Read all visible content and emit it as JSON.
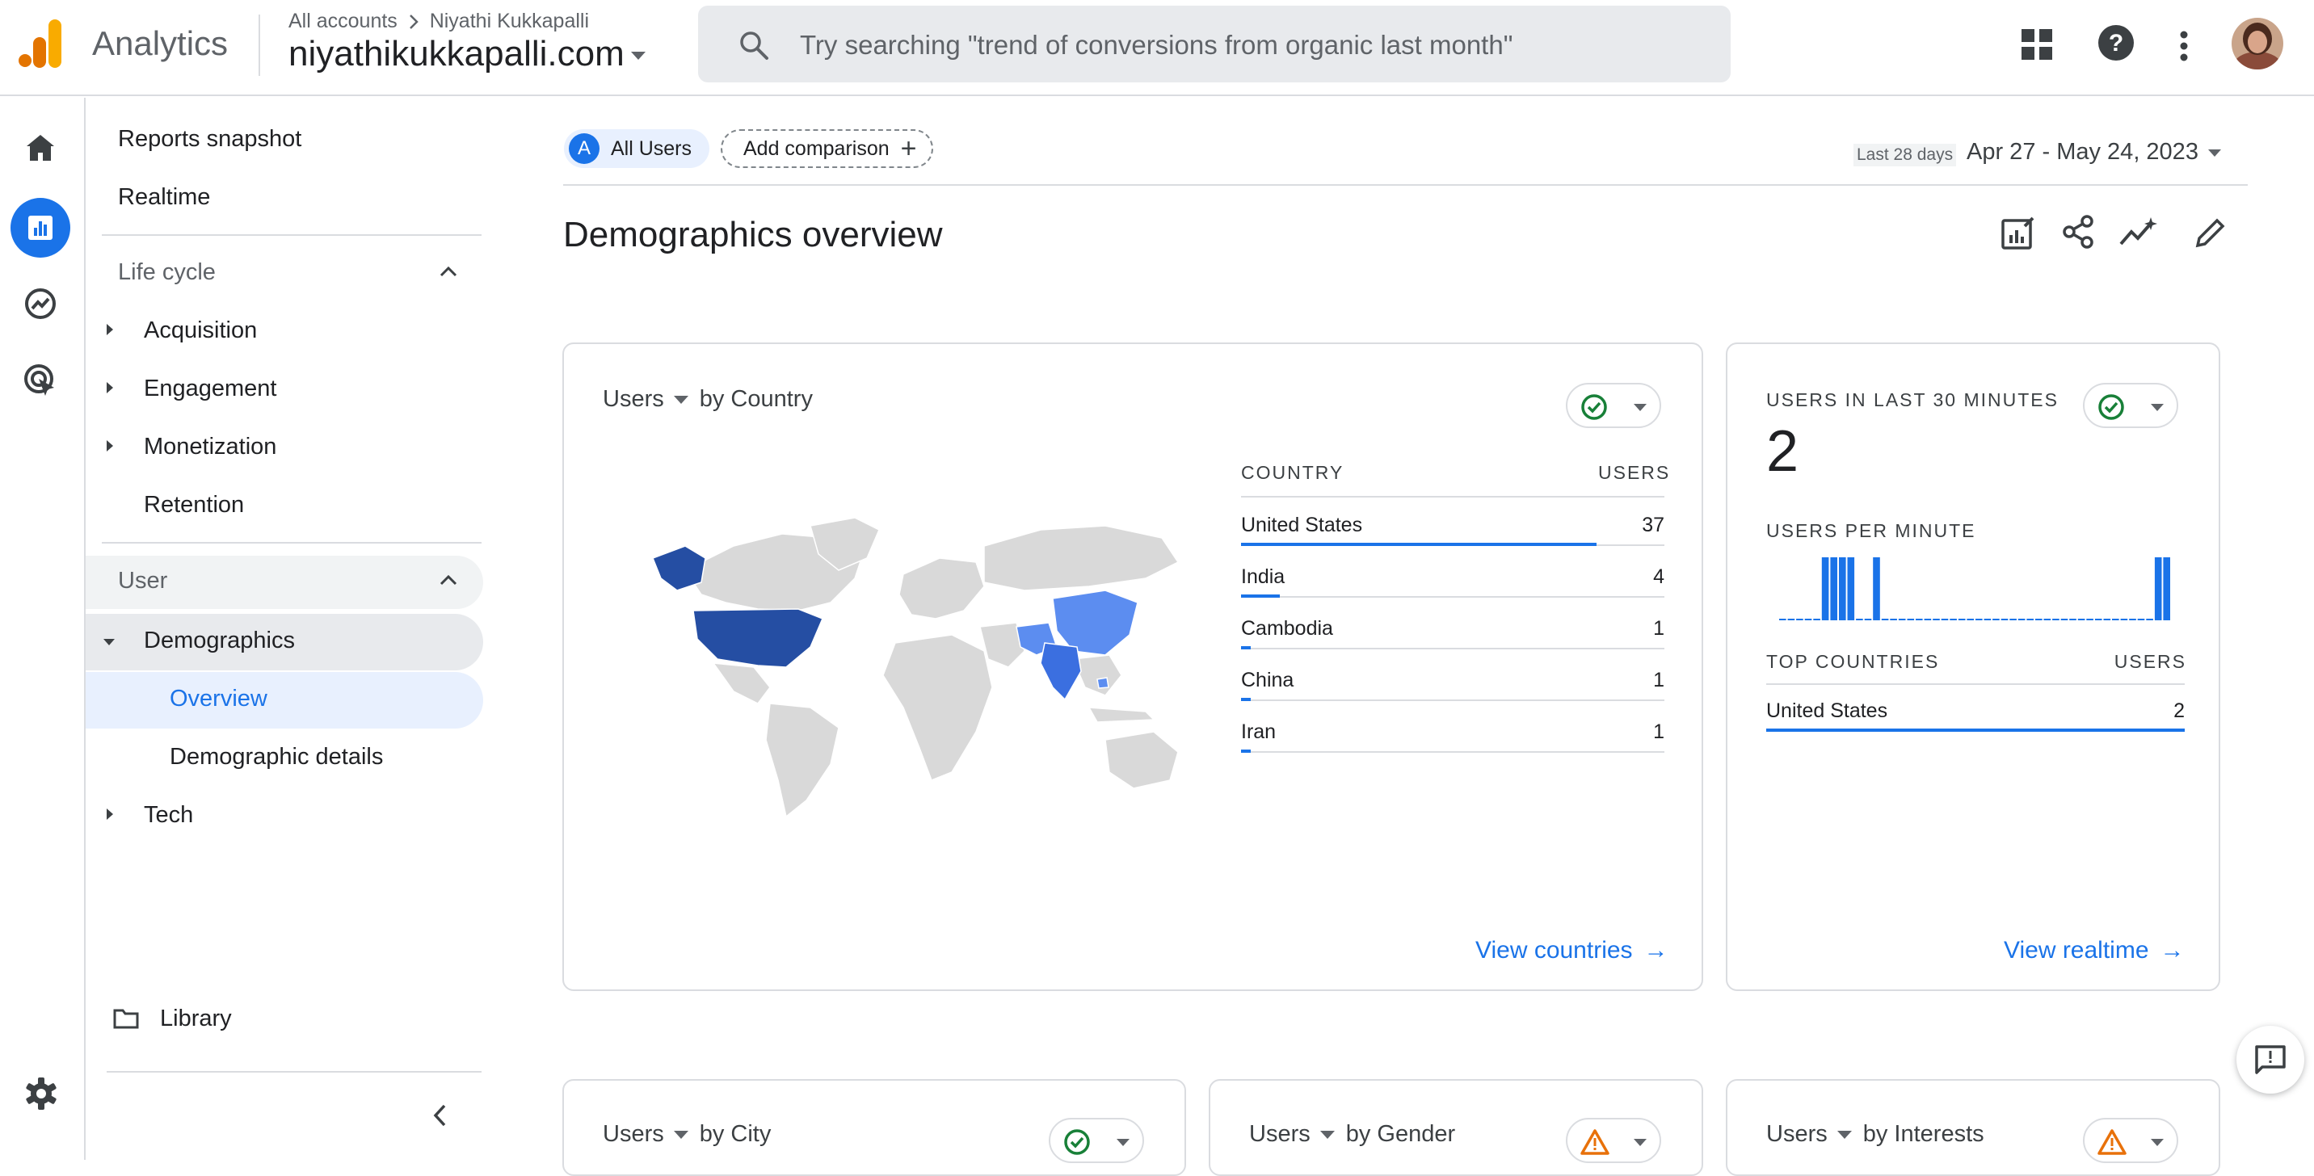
{
  "header": {
    "app_name": "Analytics",
    "breadcrumb_root": "All accounts",
    "breadcrumb_account": "Niyathi Kukkapalli",
    "property_name": "niyathikukkapalli.com",
    "search_placeholder": "Try searching \"trend of conversions from organic last month\""
  },
  "nav": {
    "reports_snapshot": "Reports snapshot",
    "realtime": "Realtime",
    "lifecycle_section": "Life cycle",
    "acquisition": "Acquisition",
    "engagement": "Engagement",
    "monetization": "Monetization",
    "retention": "Retention",
    "user_section": "User",
    "demographics": "Demographics",
    "overview": "Overview",
    "demographic_details": "Demographic details",
    "tech": "Tech",
    "library": "Library"
  },
  "toolbar": {
    "segment_avatar": "A",
    "segment_label": "All Users",
    "add_comparison": "Add comparison",
    "date_preset": "Last 28 days",
    "date_range": "Apr 27 - May 24, 2023"
  },
  "page": {
    "title": "Demographics overview"
  },
  "country_card": {
    "metric": "Users",
    "dimension": "by Country",
    "col_dimension": "COUNTRY",
    "col_metric": "USERS",
    "rows": [
      {
        "name": "United States",
        "value": "37",
        "fraction": 1.0
      },
      {
        "name": "India",
        "value": "4",
        "fraction": 0.108
      },
      {
        "name": "Cambodia",
        "value": "1",
        "fraction": 0.027
      },
      {
        "name": "China",
        "value": "1",
        "fraction": 0.027
      },
      {
        "name": "Iran",
        "value": "1",
        "fraction": 0.027
      }
    ],
    "link": "View countries",
    "colors": {
      "top": "#254ea3",
      "mid": "#3b6fe0",
      "low": "#5c8df0",
      "none": "#d9d9d9"
    }
  },
  "realtime_card": {
    "title": "USERS IN LAST 30 MINUTES",
    "value": "2",
    "per_minute_label": "USERS PER MINUTE",
    "per_minute": [
      0,
      0,
      0,
      0,
      0,
      1,
      1,
      1,
      1,
      0,
      0,
      1,
      0,
      0,
      0,
      0,
      0,
      0,
      0,
      0,
      0,
      0,
      0,
      0,
      0,
      0,
      0,
      0,
      0,
      0,
      0,
      0,
      0,
      0,
      0,
      0,
      0,
      0,
      0,
      0,
      0,
      0,
      0,
      0,
      1,
      1
    ],
    "top_countries_label": "TOP COUNTRIES",
    "users_label": "USERS",
    "rows": [
      {
        "name": "United States",
        "value": "2"
      }
    ],
    "link": "View realtime"
  },
  "bottom_cards": [
    {
      "metric": "Users",
      "dimension": "by City",
      "status": "ok"
    },
    {
      "metric": "Users",
      "dimension": "by Gender",
      "status": "warning"
    },
    {
      "metric": "Users",
      "dimension": "by Interests",
      "status": "warning"
    }
  ]
}
